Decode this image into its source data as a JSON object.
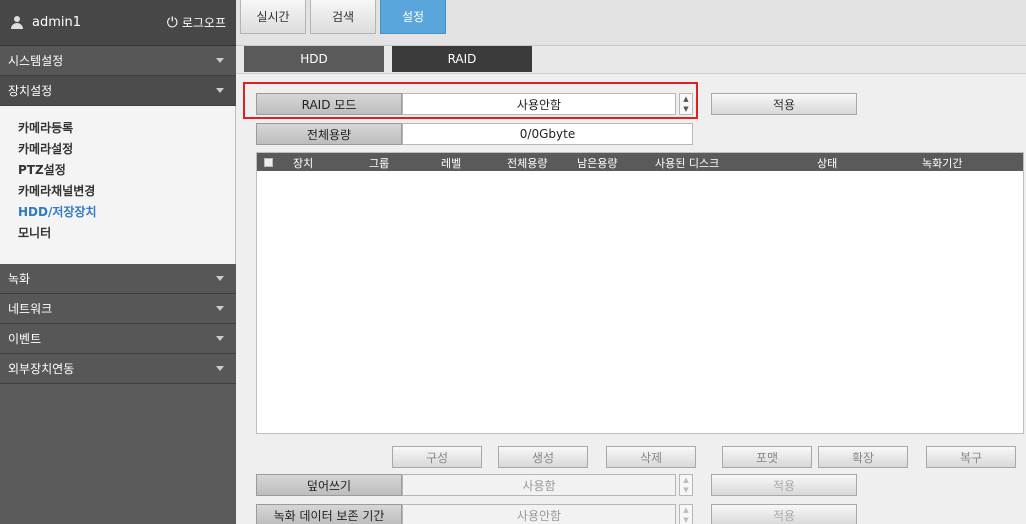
{
  "user": {
    "name": "admin1",
    "logout_label": "로그오프"
  },
  "sidebar": {
    "sections": [
      {
        "label": "시스템설정"
      },
      {
        "label": "장치설정"
      },
      {
        "label": "녹화"
      },
      {
        "label": "네트워크"
      },
      {
        "label": "이벤트"
      },
      {
        "label": "외부장치연동"
      }
    ],
    "device_items": [
      "카메라등록",
      "카메라설정",
      "PTZ설정",
      "카메라채널변경",
      "HDD/저장장치",
      "모니터"
    ],
    "active_item": "HDD/저장장치"
  },
  "top_tabs": [
    "실시간",
    "검색",
    "설정"
  ],
  "active_top_tab": "설정",
  "sub_tabs": [
    "HDD",
    "RAID"
  ],
  "raid": {
    "mode_label": "RAID 모드",
    "mode_value": "사용안함",
    "apply_label": "적용",
    "capacity_label": "전체용량",
    "capacity_value": "0/0Gbyte"
  },
  "table_headers": [
    "장치",
    "그룹",
    "레벨",
    "전체용량",
    "남은용량",
    "사용된 디스크",
    "상태",
    "녹화기간"
  ],
  "actions": [
    "구성",
    "생성",
    "삭제",
    "포맷",
    "확장",
    "복구"
  ],
  "overwrite": {
    "label": "덮어쓰기",
    "value": "사용함",
    "apply_label": "적용"
  },
  "retention": {
    "label": "녹화 데이터 보존 기간",
    "value": "사용안함",
    "apply_label": "적용"
  }
}
